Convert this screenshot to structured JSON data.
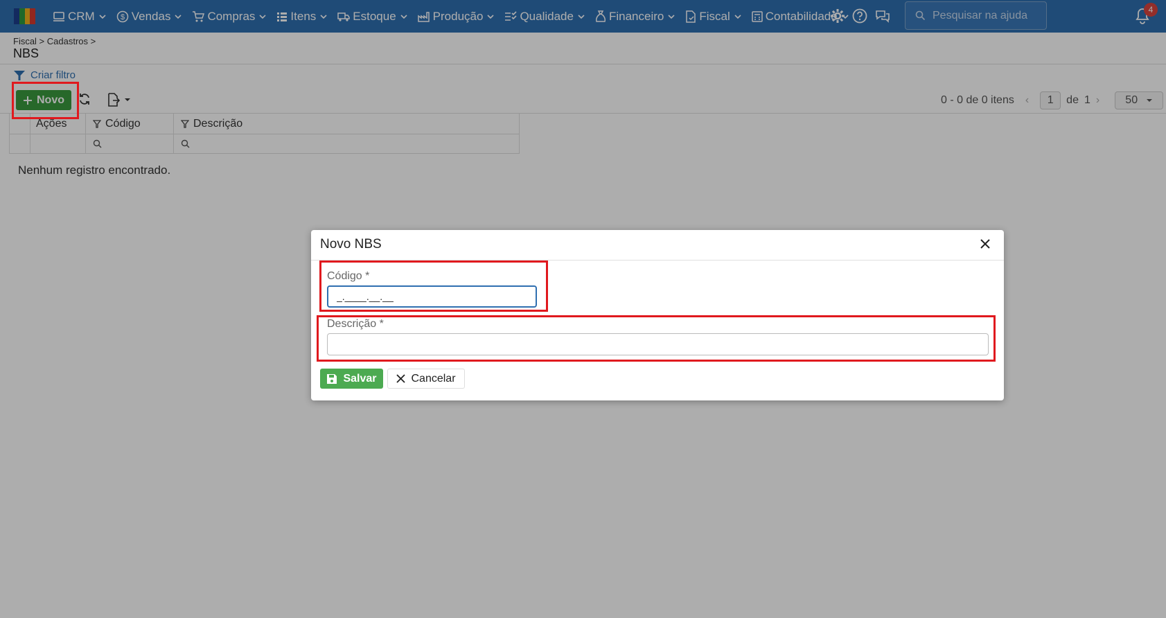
{
  "topbar": {
    "menu": [
      {
        "label": "CRM",
        "icon": "crm-icon"
      },
      {
        "label": "Vendas",
        "icon": "dollar-icon"
      },
      {
        "label": "Compras",
        "icon": "cart-icon"
      },
      {
        "label": "Itens",
        "icon": "items-icon"
      },
      {
        "label": "Estoque",
        "icon": "truck-icon"
      },
      {
        "label": "Produção",
        "icon": "factory-icon"
      },
      {
        "label": "Qualidade",
        "icon": "checklist-icon"
      },
      {
        "label": "Financeiro",
        "icon": "money-bag-icon"
      },
      {
        "label": "Fiscal",
        "icon": "document-icon"
      },
      {
        "label": "Contabilidade",
        "icon": "calculator-icon"
      }
    ],
    "help_search_placeholder": "Pesquisar na ajuda",
    "notification_count": "4"
  },
  "page": {
    "breadcrumb": "Fiscal > Cadastros >",
    "title": "NBS",
    "filter_link": "Criar filtro",
    "new_button": "Novo"
  },
  "pager": {
    "summary": "0 - 0 de 0 itens",
    "current_page": "1",
    "of_label": "de",
    "total_pages": "1",
    "per_page": "50"
  },
  "grid": {
    "columns": [
      "Ações",
      "Código",
      "Descrição"
    ],
    "empty_message": "Nenhum registro encontrado."
  },
  "modal": {
    "title": "Novo NBS",
    "codigo_label": "Código *",
    "codigo_value": "_.____.__.__",
    "descricao_label": "Descrição *",
    "descricao_value": "",
    "save_label": "Salvar",
    "cancel_label": "Cancelar"
  },
  "colors": {
    "topbar": "#2f6fb0",
    "primary_green": "#3a9a3f",
    "highlight_red": "#e0191e"
  }
}
